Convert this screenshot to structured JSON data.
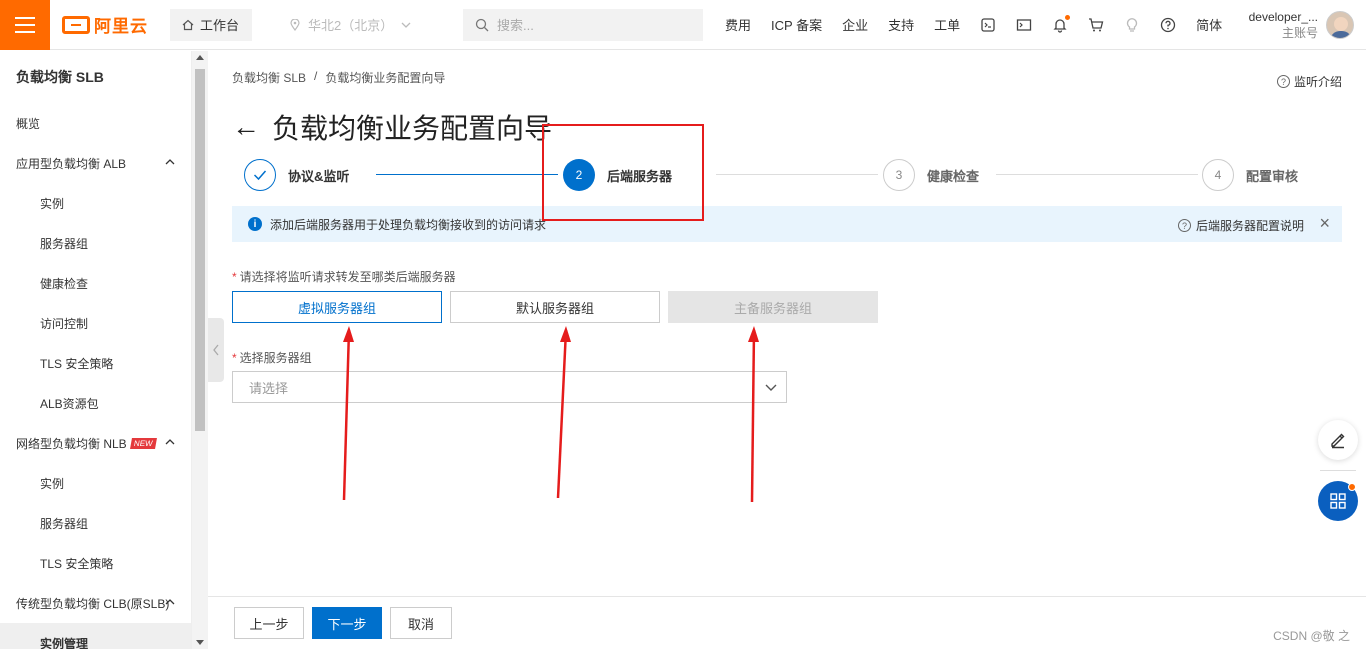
{
  "topbar": {
    "logo_text": "阿里云",
    "workbench": "工作台",
    "region": "华北2（北京）",
    "search_placeholder": "搜索...",
    "nav": [
      "费用",
      "ICP 备案",
      "企业",
      "支持",
      "工单"
    ],
    "lang": "简体",
    "user_name": "developer_...",
    "user_role": "主账号",
    "accent_color": "#ff6a00"
  },
  "sidebar": {
    "title": "负载均衡 SLB",
    "items": [
      {
        "label": "概览",
        "level": 0
      },
      {
        "label": "应用型负载均衡 ALB",
        "level": 0,
        "expandable": true
      },
      {
        "label": "实例",
        "level": 1
      },
      {
        "label": "服务器组",
        "level": 1
      },
      {
        "label": "健康检查",
        "level": 1
      },
      {
        "label": "访问控制",
        "level": 1
      },
      {
        "label": "TLS 安全策略",
        "level": 1
      },
      {
        "label": "ALB资源包",
        "level": 1
      },
      {
        "label": "网络型负载均衡 NLB",
        "level": 0,
        "expandable": true,
        "badge": "NEW"
      },
      {
        "label": "实例",
        "level": 1
      },
      {
        "label": "服务器组",
        "level": 1
      },
      {
        "label": "TLS 安全策略",
        "level": 1
      },
      {
        "label": "传统型负载均衡 CLB(原SLB)",
        "level": 0,
        "expandable": true
      },
      {
        "label": "实例管理",
        "level": 1,
        "active": true
      }
    ]
  },
  "main": {
    "breadcrumb": [
      "负载均衡 SLB",
      "/",
      "负载均衡业务配置向导"
    ],
    "help_link": "监听介绍",
    "title": "负载均衡业务配置向导",
    "steps": [
      {
        "index": "",
        "label": "协议&监听",
        "state": "done"
      },
      {
        "index": "2",
        "label": "后端服务器",
        "state": "current"
      },
      {
        "index": "3",
        "label": "健康检查",
        "state": "todo"
      },
      {
        "index": "4",
        "label": "配置审核",
        "state": "todo"
      }
    ],
    "alert_text": "添加后端服务器用于处理负载均衡接收到的访问请求",
    "alert_link": "后端服务器配置说明",
    "server_type_label": "请选择将监听请求转发至哪类后端服务器",
    "server_types": [
      {
        "label": "虚拟服务器组",
        "state": "selected"
      },
      {
        "label": "默认服务器组",
        "state": "normal"
      },
      {
        "label": "主备服务器组",
        "state": "disabled"
      }
    ],
    "group_label": "选择服务器组",
    "group_placeholder": "请选择"
  },
  "footer": {
    "prev": "上一步",
    "next": "下一步",
    "cancel": "取消",
    "watermark": "CSDN @敬 之",
    "primary_color": "#0070cc"
  }
}
